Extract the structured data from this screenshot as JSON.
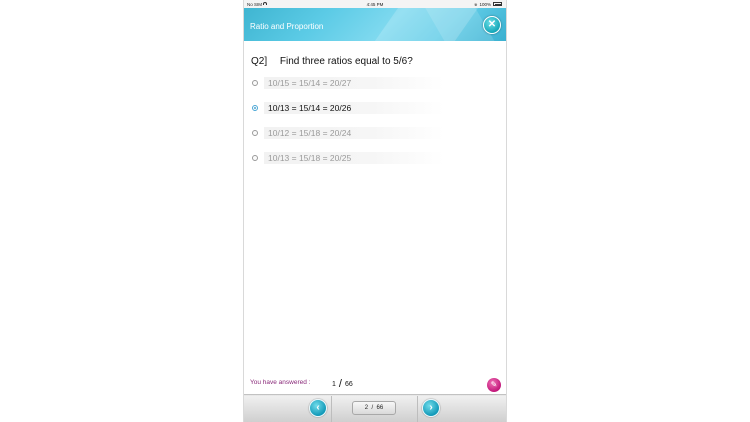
{
  "status_bar": {
    "carrier": "No SIM",
    "time": "4:45 PM",
    "battery": "100%"
  },
  "header": {
    "title": "Ratio and Proportion",
    "close_icon": "close-icon",
    "accent_color": "#4fc3df"
  },
  "question": {
    "number": "Q2]",
    "text": "Find three ratios equal to 5/6?"
  },
  "options": [
    {
      "text": "10/15 = 15/14 = 20/27",
      "selected": false
    },
    {
      "text": "10/13 = 15/14 = 20/26",
      "selected": true
    },
    {
      "text": "10/12 = 15/18 = 20/24",
      "selected": false
    },
    {
      "text": "10/13 = 15/18 = 20/25",
      "selected": false
    }
  ],
  "footer": {
    "answered_label": "You have answered :",
    "answered_value": "1",
    "answered_separator": "/",
    "answered_total": "66",
    "edit_icon": "pencil-icon"
  },
  "navigation": {
    "prev_icon": "chevron-left-icon",
    "next_icon": "chevron-right-icon",
    "current_page": "2",
    "separator": "/",
    "total_pages": "66"
  }
}
